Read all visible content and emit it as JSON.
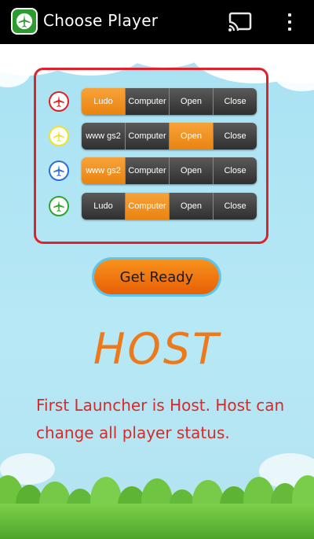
{
  "appbar": {
    "title": "Choose Player",
    "app_icon": "airplane-icon",
    "cast_icon": "cast-icon",
    "menu_icon": "overflow-menu-icon"
  },
  "players": [
    {
      "color": "#e02020",
      "segments": [
        {
          "label": "Ludo",
          "active": true
        },
        {
          "label": "Computer",
          "active": false
        },
        {
          "label": "Open",
          "active": false
        },
        {
          "label": "Close",
          "active": false
        }
      ]
    },
    {
      "color": "#f2e22a",
      "segments": [
        {
          "label": "www gs2",
          "active": false
        },
        {
          "label": "Computer",
          "active": false
        },
        {
          "label": "Open",
          "active": true
        },
        {
          "label": "Close",
          "active": false
        }
      ]
    },
    {
      "color": "#2a6fd8",
      "segments": [
        {
          "label": "www gs2",
          "active": true
        },
        {
          "label": "Computer",
          "active": false
        },
        {
          "label": "Open",
          "active": false
        },
        {
          "label": "Close",
          "active": false
        }
      ]
    },
    {
      "color": "#2fa52f",
      "segments": [
        {
          "label": "Ludo",
          "active": false
        },
        {
          "label": "Computer",
          "active": true
        },
        {
          "label": "Open",
          "active": false
        },
        {
          "label": "Close",
          "active": false
        }
      ]
    }
  ],
  "ready_button": "Get Ready",
  "host": {
    "title": "HOST",
    "description": "First Launcher is Host. Host can change all player status."
  },
  "colors": {
    "active_segment": "#f29222",
    "panel_border": "#e0202a",
    "host_title": "#ec7a1c",
    "host_text": "#d62a2a"
  }
}
